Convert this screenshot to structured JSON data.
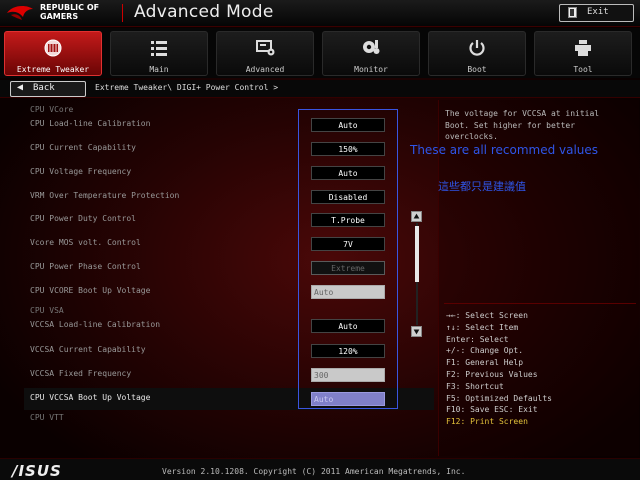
{
  "header": {
    "brand_line1": "REPUBLIC OF",
    "brand_line2": "GAMERS",
    "mode_title": "Advanced Mode",
    "exit_label": "Exit"
  },
  "tabs": [
    {
      "label": "Extreme Tweaker",
      "icon": "tweaker-icon",
      "active": true
    },
    {
      "label": "Main",
      "icon": "list-icon"
    },
    {
      "label": "Advanced",
      "icon": "advanced-icon"
    },
    {
      "label": "Monitor",
      "icon": "monitor-gear-icon"
    },
    {
      "label": "Boot",
      "icon": "power-icon"
    },
    {
      "label": "Tool",
      "icon": "printer-icon"
    }
  ],
  "breadcrumb": {
    "back_label": "Back",
    "path": "Extreme Tweaker\\ DIGI+ Power Control >"
  },
  "settings": [
    {
      "label": "CPU VCore",
      "type": "section"
    },
    {
      "label": "CPU Load-line Calibration",
      "value": "Auto"
    },
    {
      "label": "CPU Current Capability",
      "value": "150%"
    },
    {
      "label": "CPU Voltage Frequency",
      "value": "Auto"
    },
    {
      "label": "VRM Over Temperature Protection",
      "value": "Disabled"
    },
    {
      "label": "CPU Power Duty Control",
      "value": "T.Probe"
    },
    {
      "label": "Vcore MOS volt. Control",
      "value": "7V"
    },
    {
      "label": "CPU Power Phase Control",
      "value": "Extreme",
      "state": "disabled"
    },
    {
      "label": "CPU VCORE Boot Up Voltage",
      "value": "Auto",
      "state": "input"
    },
    {
      "label": "CPU VSA",
      "type": "section"
    },
    {
      "label": "VCCSA Load-line Calibration",
      "value": "Auto"
    },
    {
      "label": "VCCSA Current Capability",
      "value": "120%"
    },
    {
      "label": "VCCSA Fixed Frequency",
      "value": "300",
      "state": "input"
    },
    {
      "label": "CPU VCCSA Boot Up Voltage",
      "value": "Auto",
      "state": "input",
      "selected": true
    },
    {
      "label": "CPU VTT",
      "type": "section"
    }
  ],
  "help": {
    "description": "The voltage for VCCSA at initial Boot. Set higher for better overclocks."
  },
  "keys": [
    {
      "text": "→←: Select Screen"
    },
    {
      "text": "↑↓: Select Item"
    },
    {
      "text": "Enter: Select"
    },
    {
      "text": "+/-: Change Opt."
    },
    {
      "text": "F1: General Help"
    },
    {
      "text": "F2: Previous Values"
    },
    {
      "text": "F3: Shortcut"
    },
    {
      "text": "F5: Optimized Defaults"
    },
    {
      "text": "F10: Save  ESC: Exit"
    },
    {
      "text": "F12: Print Screen",
      "highlight": true
    }
  ],
  "annotations": {
    "english": "These are all recommed values",
    "chinese": "這些都只是建議值"
  },
  "footer": {
    "logo": "/ISUS",
    "copyright": "Version 2.10.1208. Copyright (C) 2011 American Megatrends, Inc."
  },
  "scrollbar": {
    "position_fraction": 0.0,
    "visible_fraction": 0.55
  },
  "colors": {
    "accent": "#c41a1a",
    "annotation": "#2f55e8",
    "highlight_key": "#e3c23a"
  }
}
